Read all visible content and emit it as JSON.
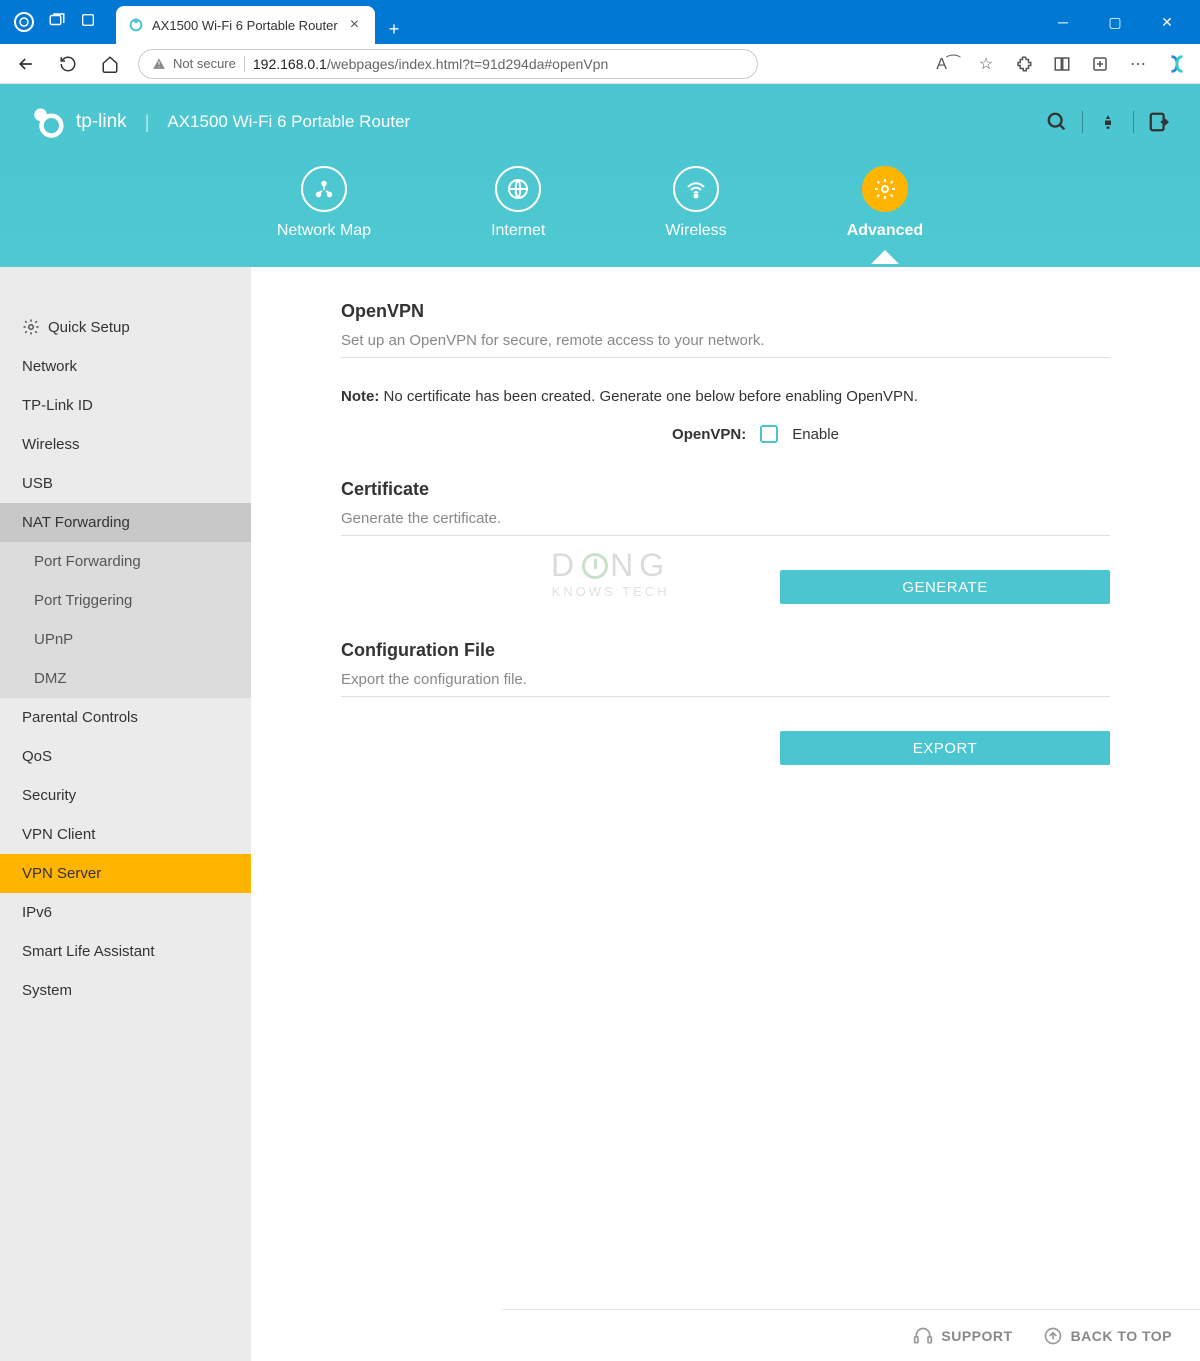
{
  "browser": {
    "tab_title": "AX1500 Wi-Fi 6 Portable Router",
    "url_insecure": "Not secure",
    "url_dark": "192.168.0.1",
    "url_rest": "/webpages/index.html?t=91d294da#openVpn"
  },
  "header": {
    "brand": "tp-link",
    "device": "AX1500 Wi-Fi 6 Portable Router",
    "tabs": [
      "Network Map",
      "Internet",
      "Wireless",
      "Advanced"
    ],
    "active_tab": 3
  },
  "sidebar": {
    "items": [
      {
        "label": "Quick Setup",
        "icon": true
      },
      {
        "label": "Network"
      },
      {
        "label": "TP-Link ID"
      },
      {
        "label": "Wireless"
      },
      {
        "label": "USB"
      },
      {
        "label": "NAT Forwarding",
        "expanded": true,
        "children": [
          "Port Forwarding",
          "Port Triggering",
          "UPnP",
          "DMZ"
        ]
      },
      {
        "label": "Parental Controls"
      },
      {
        "label": "QoS"
      },
      {
        "label": "Security"
      },
      {
        "label": "VPN Client"
      },
      {
        "label": "VPN Server",
        "active": true
      },
      {
        "label": "IPv6"
      },
      {
        "label": "Smart Life Assistant"
      },
      {
        "label": "System"
      }
    ]
  },
  "content": {
    "s1": {
      "title": "OpenVPN",
      "desc": "Set up an OpenVPN for secure, remote access to your network.",
      "note_label": "Note:",
      "note_text": " No certificate has been created. Generate one below before enabling OpenVPN.",
      "field_label": "OpenVPN:",
      "field_option": "Enable"
    },
    "s2": {
      "title": "Certificate",
      "desc": "Generate the certificate.",
      "button": "GENERATE"
    },
    "s3": {
      "title": "Configuration File",
      "desc": "Export the configuration file.",
      "button": "EXPORT"
    }
  },
  "footer": {
    "support": "SUPPORT",
    "back": "BACK TO TOP"
  },
  "watermark": {
    "l1a": "D",
    "l1b": "NG",
    "l2": "KNOWS TECH"
  }
}
